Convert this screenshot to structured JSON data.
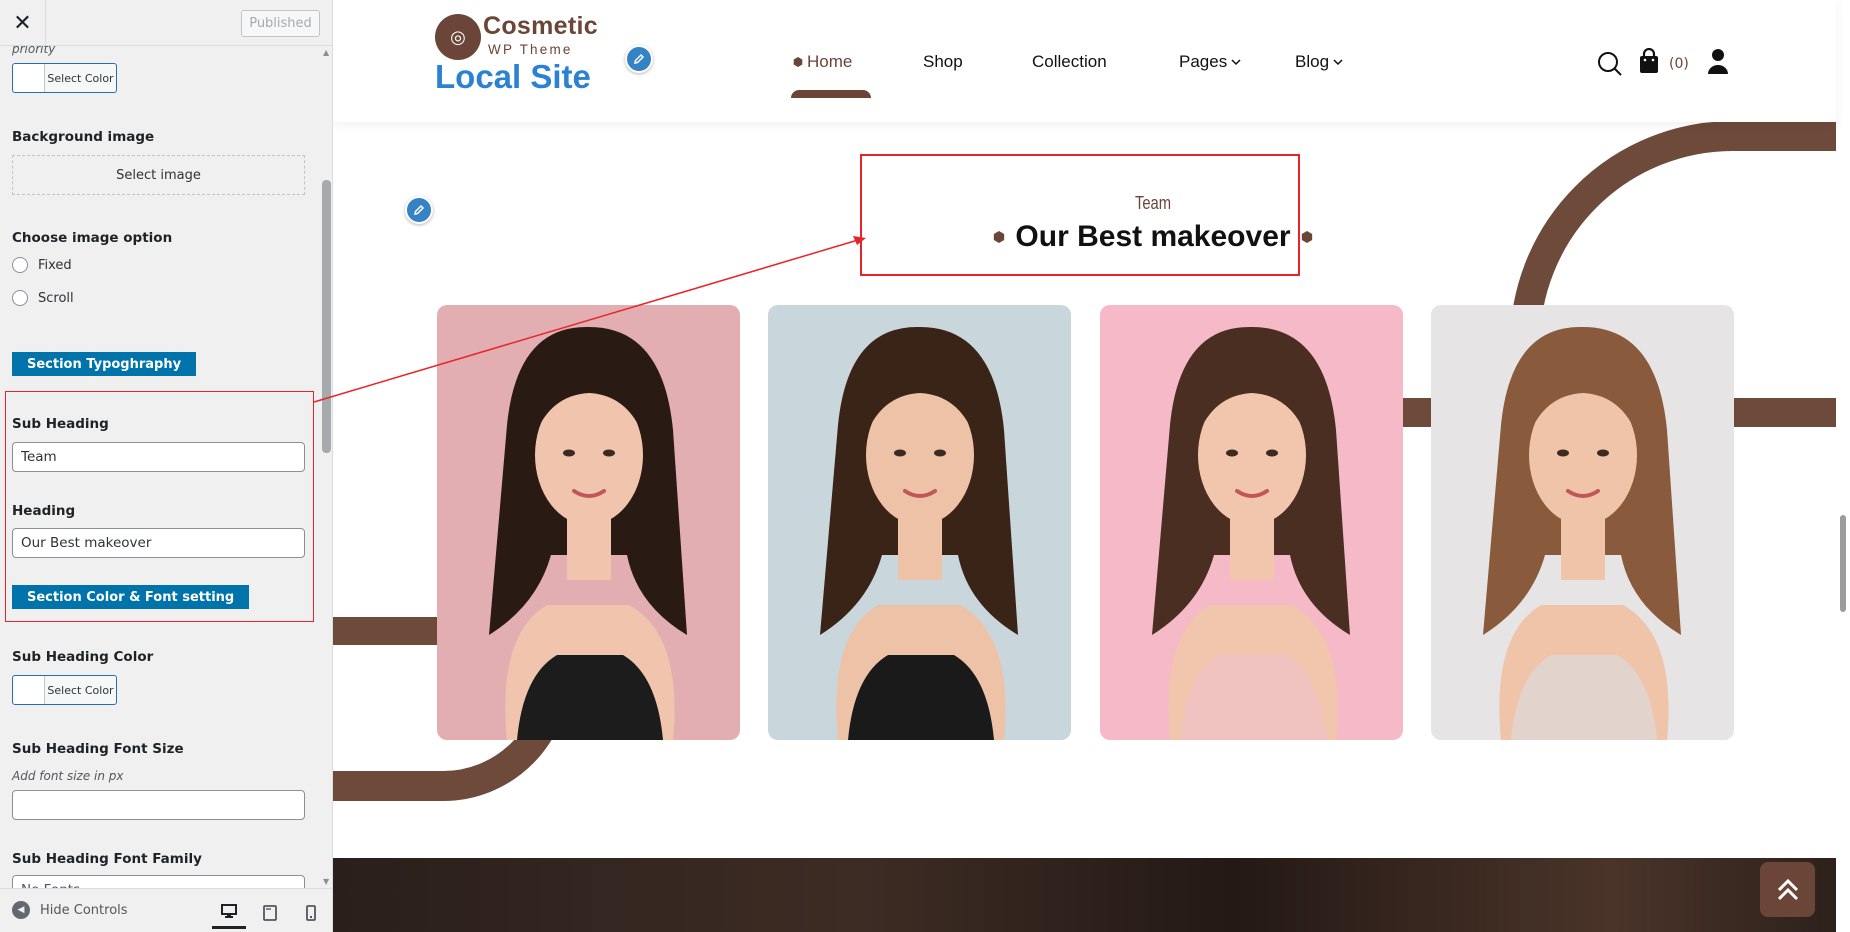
{
  "customizer": {
    "close_glyph": "✕",
    "published_label": "Published",
    "priority_text": "priority",
    "select_color_label": "Select Color",
    "background_image_label": "Background image",
    "select_image_label": "Select image",
    "image_option_label": "Choose image option",
    "radio_options": [
      "Fixed",
      "Scroll"
    ],
    "typography_badge": "Section Typoghraphy",
    "sub_heading_label": "Sub Heading",
    "sub_heading_value": "Team",
    "heading_label": "Heading",
    "heading_value": "Our Best makeover",
    "color_font_badge": "Section Color & Font setting",
    "sub_heading_color_label": "Sub Heading Color",
    "sub_heading_font_size_label": "Sub Heading Font Size",
    "font_size_hint": "Add font size in px",
    "sub_heading_font_family_label": "Sub Heading Font Family",
    "font_family_partial": "No Fonts",
    "hide_controls_label": "Hide Controls",
    "accent_color": "#0073aa",
    "highlight_color": "#e8242a"
  },
  "site": {
    "logo_title": "Cosmetic",
    "logo_tagline": "WP Theme",
    "site_title": "Local Site",
    "nav": {
      "home": "Home",
      "shop": "Shop",
      "collection": "Collection",
      "pages": "Pages",
      "blog": "Blog"
    },
    "cart_count": "(0)",
    "brand_color": "#6b4537",
    "title_color": "#2b82d2"
  },
  "team_section": {
    "sub_heading": "Team",
    "heading": "Our Best makeover",
    "members": [
      {
        "bg": "#e3aeb1",
        "hair": "#2a1a14",
        "top": "#1c1c1c",
        "skin": "#f1c5ad"
      },
      {
        "bg": "#c9d6dc",
        "hair": "#3a2418",
        "top": "#1a1a1a",
        "skin": "#eec2a6"
      },
      {
        "bg": "#f5b9c8",
        "hair": "#4a2e22",
        "top": "#f0c3c0",
        "skin": "#f2c6ac"
      },
      {
        "bg": "#e6e4e4",
        "hair": "#8a5a3c",
        "top": "#e2d4cc",
        "skin": "#efc4a8"
      }
    ]
  }
}
